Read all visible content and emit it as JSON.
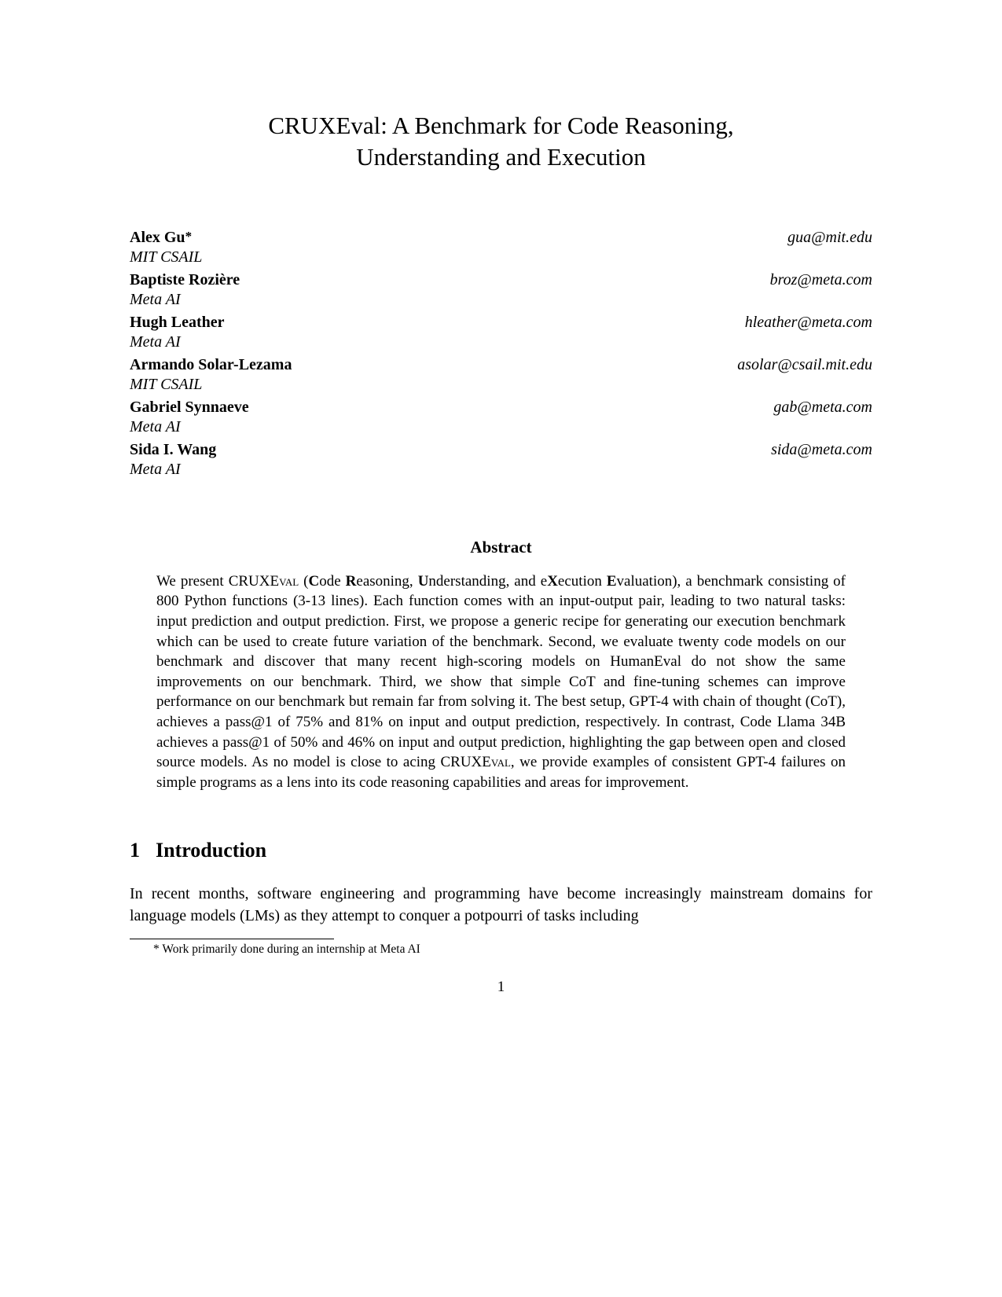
{
  "title_line1": "CRUXEval: A Benchmark for Code Reasoning,",
  "title_line2": "Understanding and Execution",
  "authors": [
    {
      "name": "Alex Gu",
      "star": "*",
      "affiliation": "MIT CSAIL",
      "email": "gua@mit.edu"
    },
    {
      "name": "Baptiste Rozière",
      "star": "",
      "affiliation": "Meta AI",
      "email": "broz@meta.com"
    },
    {
      "name": "Hugh Leather",
      "star": "",
      "affiliation": "Meta AI",
      "email": "hleather@meta.com"
    },
    {
      "name": "Armando Solar-Lezama",
      "star": "",
      "affiliation": "MIT CSAIL",
      "email": "asolar@csail.mit.edu"
    },
    {
      "name": "Gabriel Synnaeve",
      "star": "",
      "affiliation": "Meta AI",
      "email": "gab@meta.com"
    },
    {
      "name": "Sida I. Wang",
      "star": "",
      "affiliation": "Meta AI",
      "email": "sida@meta.com"
    }
  ],
  "abstract_heading": "Abstract",
  "abstract_pre": "We present CRUXE",
  "abstract_smallcaps1": "val",
  "abstract_mid1": " (",
  "abstract_bold": {
    "c": "C",
    "r": "R",
    "u": "U",
    "x": "X",
    "e": "E"
  },
  "abstract_plain": {
    "ode": "ode ",
    "easoning": "easoning, ",
    "nderstanding": "nderstanding, and e",
    "ecution": "ecution ",
    "valuation": "valuation), a benchmark consisting of 800 Python functions (3-13 lines). Each function comes with an input-output pair, leading to two natural tasks: input prediction and output prediction. First, we propose a generic recipe for generating our execution benchmark which can be used to create future variation of the benchmark. Second, we evaluate twenty code models on our benchmark and discover that many recent high-scoring models on HumanEval do not show the same improvements on our benchmark. Third, we show that simple CoT and fine-tuning schemes can improve performance on our benchmark but remain far from solving it. The best setup, GPT-4 with chain of thought (CoT), achieves a pass@1 of 75% and 81% on input and output prediction, respectively. In contrast, Code Llama 34B achieves a pass@1 of 50% and 46% on input and output prediction, highlighting the gap between open and closed source models. As no model is close to acing CRUXE"
  },
  "abstract_smallcaps2": "val",
  "abstract_tail": ", we provide examples of consistent GPT-4 failures on simple programs as a lens into its code reasoning capabilities and areas for improvement.",
  "section1_number": "1",
  "section1_title": "Introduction",
  "intro_text": "In recent months, software engineering and programming have become increasingly mainstream domains for language models (LMs) as they attempt to conquer a potpourri of tasks including",
  "footnote_marker": "*",
  "footnote_text": " Work primarily done during an internship at Meta AI",
  "page_number": "1"
}
